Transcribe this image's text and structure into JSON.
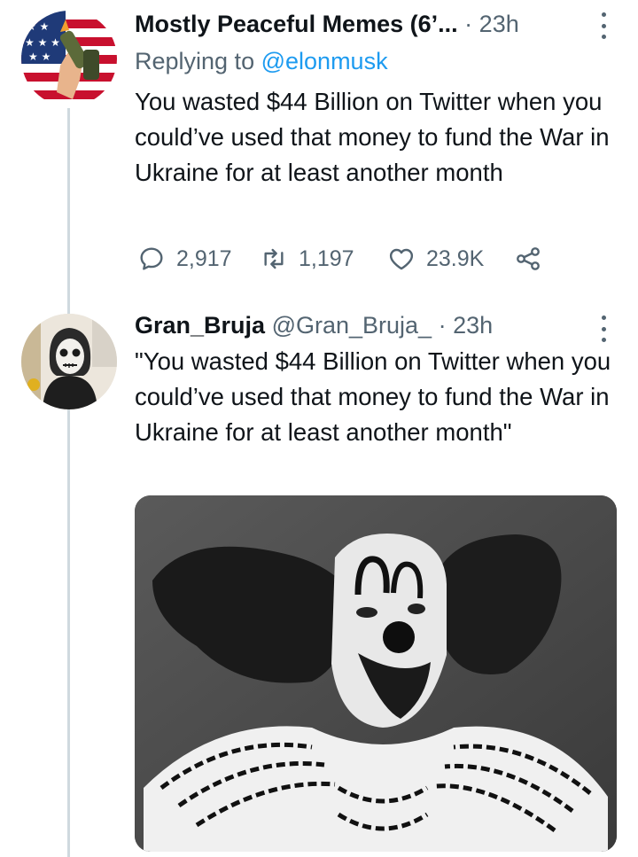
{
  "tweet1": {
    "display_name": "Mostly Peaceful Memes (6’...",
    "dot": "·",
    "time": "23h",
    "reply_prefix": "Replying to",
    "reply_mention": "@elonmusk",
    "text": "You wasted $44 Billion on Twitter when you could’ve used that money to fund the War in Ukraine for at least another month",
    "stats": {
      "replies": "2,917",
      "retweets": "1,197",
      "likes": "23.9K"
    }
  },
  "tweet2": {
    "display_name": "Gran_Bruja",
    "handle": "@Gran_Bruja_",
    "dot": "·",
    "time": "23h",
    "text": "\"You wasted $44 Billion on Twitter when you could’ve used that money to fund the War in Ukraine for at least another month\""
  },
  "colors": {
    "text": "#0f1419",
    "secondary": "#536471",
    "link": "#1d9bf0",
    "thread_line": "#cfd9de"
  },
  "icons": {
    "reply": "speech-bubble-icon",
    "retweet": "retweet-arrows-icon",
    "like": "heart-icon",
    "share": "share-icon",
    "more": "more-options-icon"
  }
}
